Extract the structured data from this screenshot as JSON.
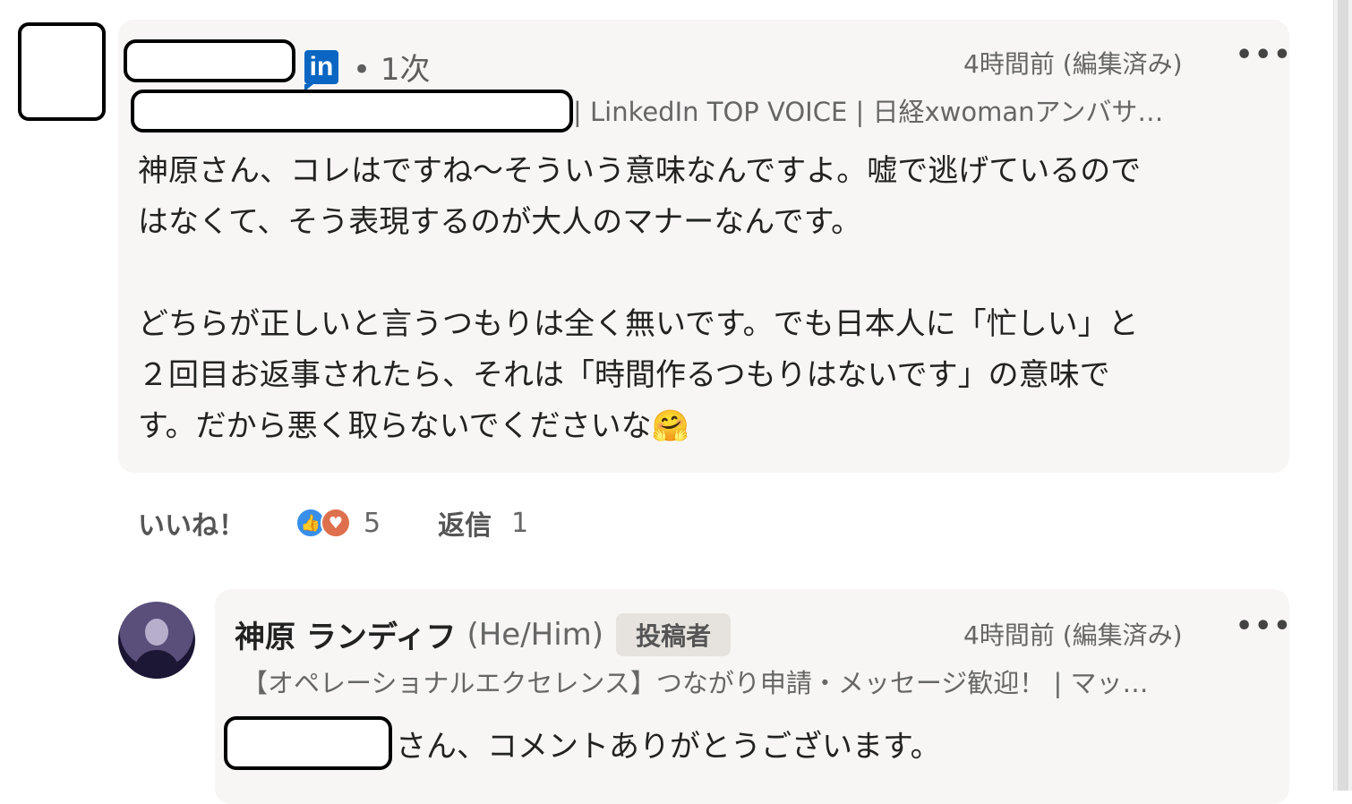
{
  "comment": {
    "li_badge": "in",
    "degree": "• 1次",
    "timestamp": "4時間前 (編集済み)",
    "more": "•••",
    "headline": "| LinkedIn TOP VOICE | 日経xwomanアンバサ…",
    "body_lines": [
      "神原さん、コレはですね～そういう意味なんですよ。嘘で逃げているので",
      "はなくて、そう表現するのが大人のマナーなんです。",
      "",
      "どちらが正しいと言うつもりは全く無いです。でも日本人に「忙しい」と",
      "２回目お返事されたら、それは「時間作るつもりはないです」の意味で",
      "す。だから悪く取らないでくださいな🤗"
    ],
    "actions": {
      "like_label": "いいね！",
      "reaction_count": "5",
      "reply_label": "返信",
      "reply_count": "1"
    }
  },
  "reply": {
    "author_name": "神原 ランディフ",
    "pronoun": "(He/Him)",
    "author_tag": "投稿者",
    "timestamp": "4時間前 (編集済み)",
    "more": "•••",
    "headline": "【オペレーショナルエクセレンス】つながり申請・メッセージ歓迎！ | マッ…",
    "body": "さん、コメントありがとうございます。"
  },
  "colors": {
    "linkedin_blue": "#0a66c2",
    "like_blue": "#378fe9",
    "love_orange": "#df704d",
    "bubble_bg": "#f7f6f4"
  }
}
